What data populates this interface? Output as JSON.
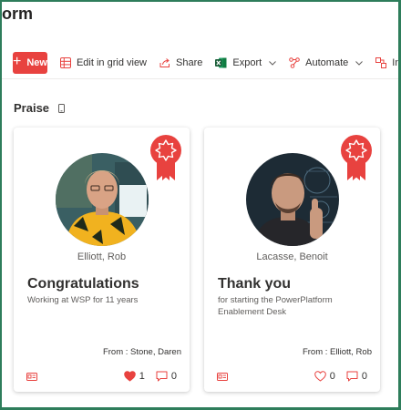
{
  "page": {
    "title": "orm"
  },
  "commandbar": {
    "new_label": "New",
    "edit_grid_label": "Edit in grid view",
    "share_label": "Share",
    "export_label": "Export",
    "automate_label": "Automate",
    "integrate_label": "Integ",
    "accent": "#e8423f"
  },
  "section": {
    "title": "Praise"
  },
  "cards": [
    {
      "name": "Elliott, Rob",
      "title": "Congratulations",
      "description": "Working at WSP for 11 years",
      "from": "From : Stone, Daren",
      "likes": "1",
      "liked": true,
      "comments": "0"
    },
    {
      "name": "Lacasse, Benoit",
      "title": "Thank you",
      "description": "for starting the PowerPlatform Enablement Desk",
      "from": "From : Elliott, Rob",
      "likes": "0",
      "liked": false,
      "comments": "0"
    }
  ],
  "icons": {
    "new": "plus-icon",
    "edit_grid": "grid-icon",
    "share": "share-icon",
    "export": "excel-icon",
    "automate": "flow-icon",
    "integrate": "integrate-icon",
    "badge": "award-ribbon-icon",
    "card_type": "id-card-icon",
    "like": "heart-icon",
    "comment": "comment-icon"
  }
}
